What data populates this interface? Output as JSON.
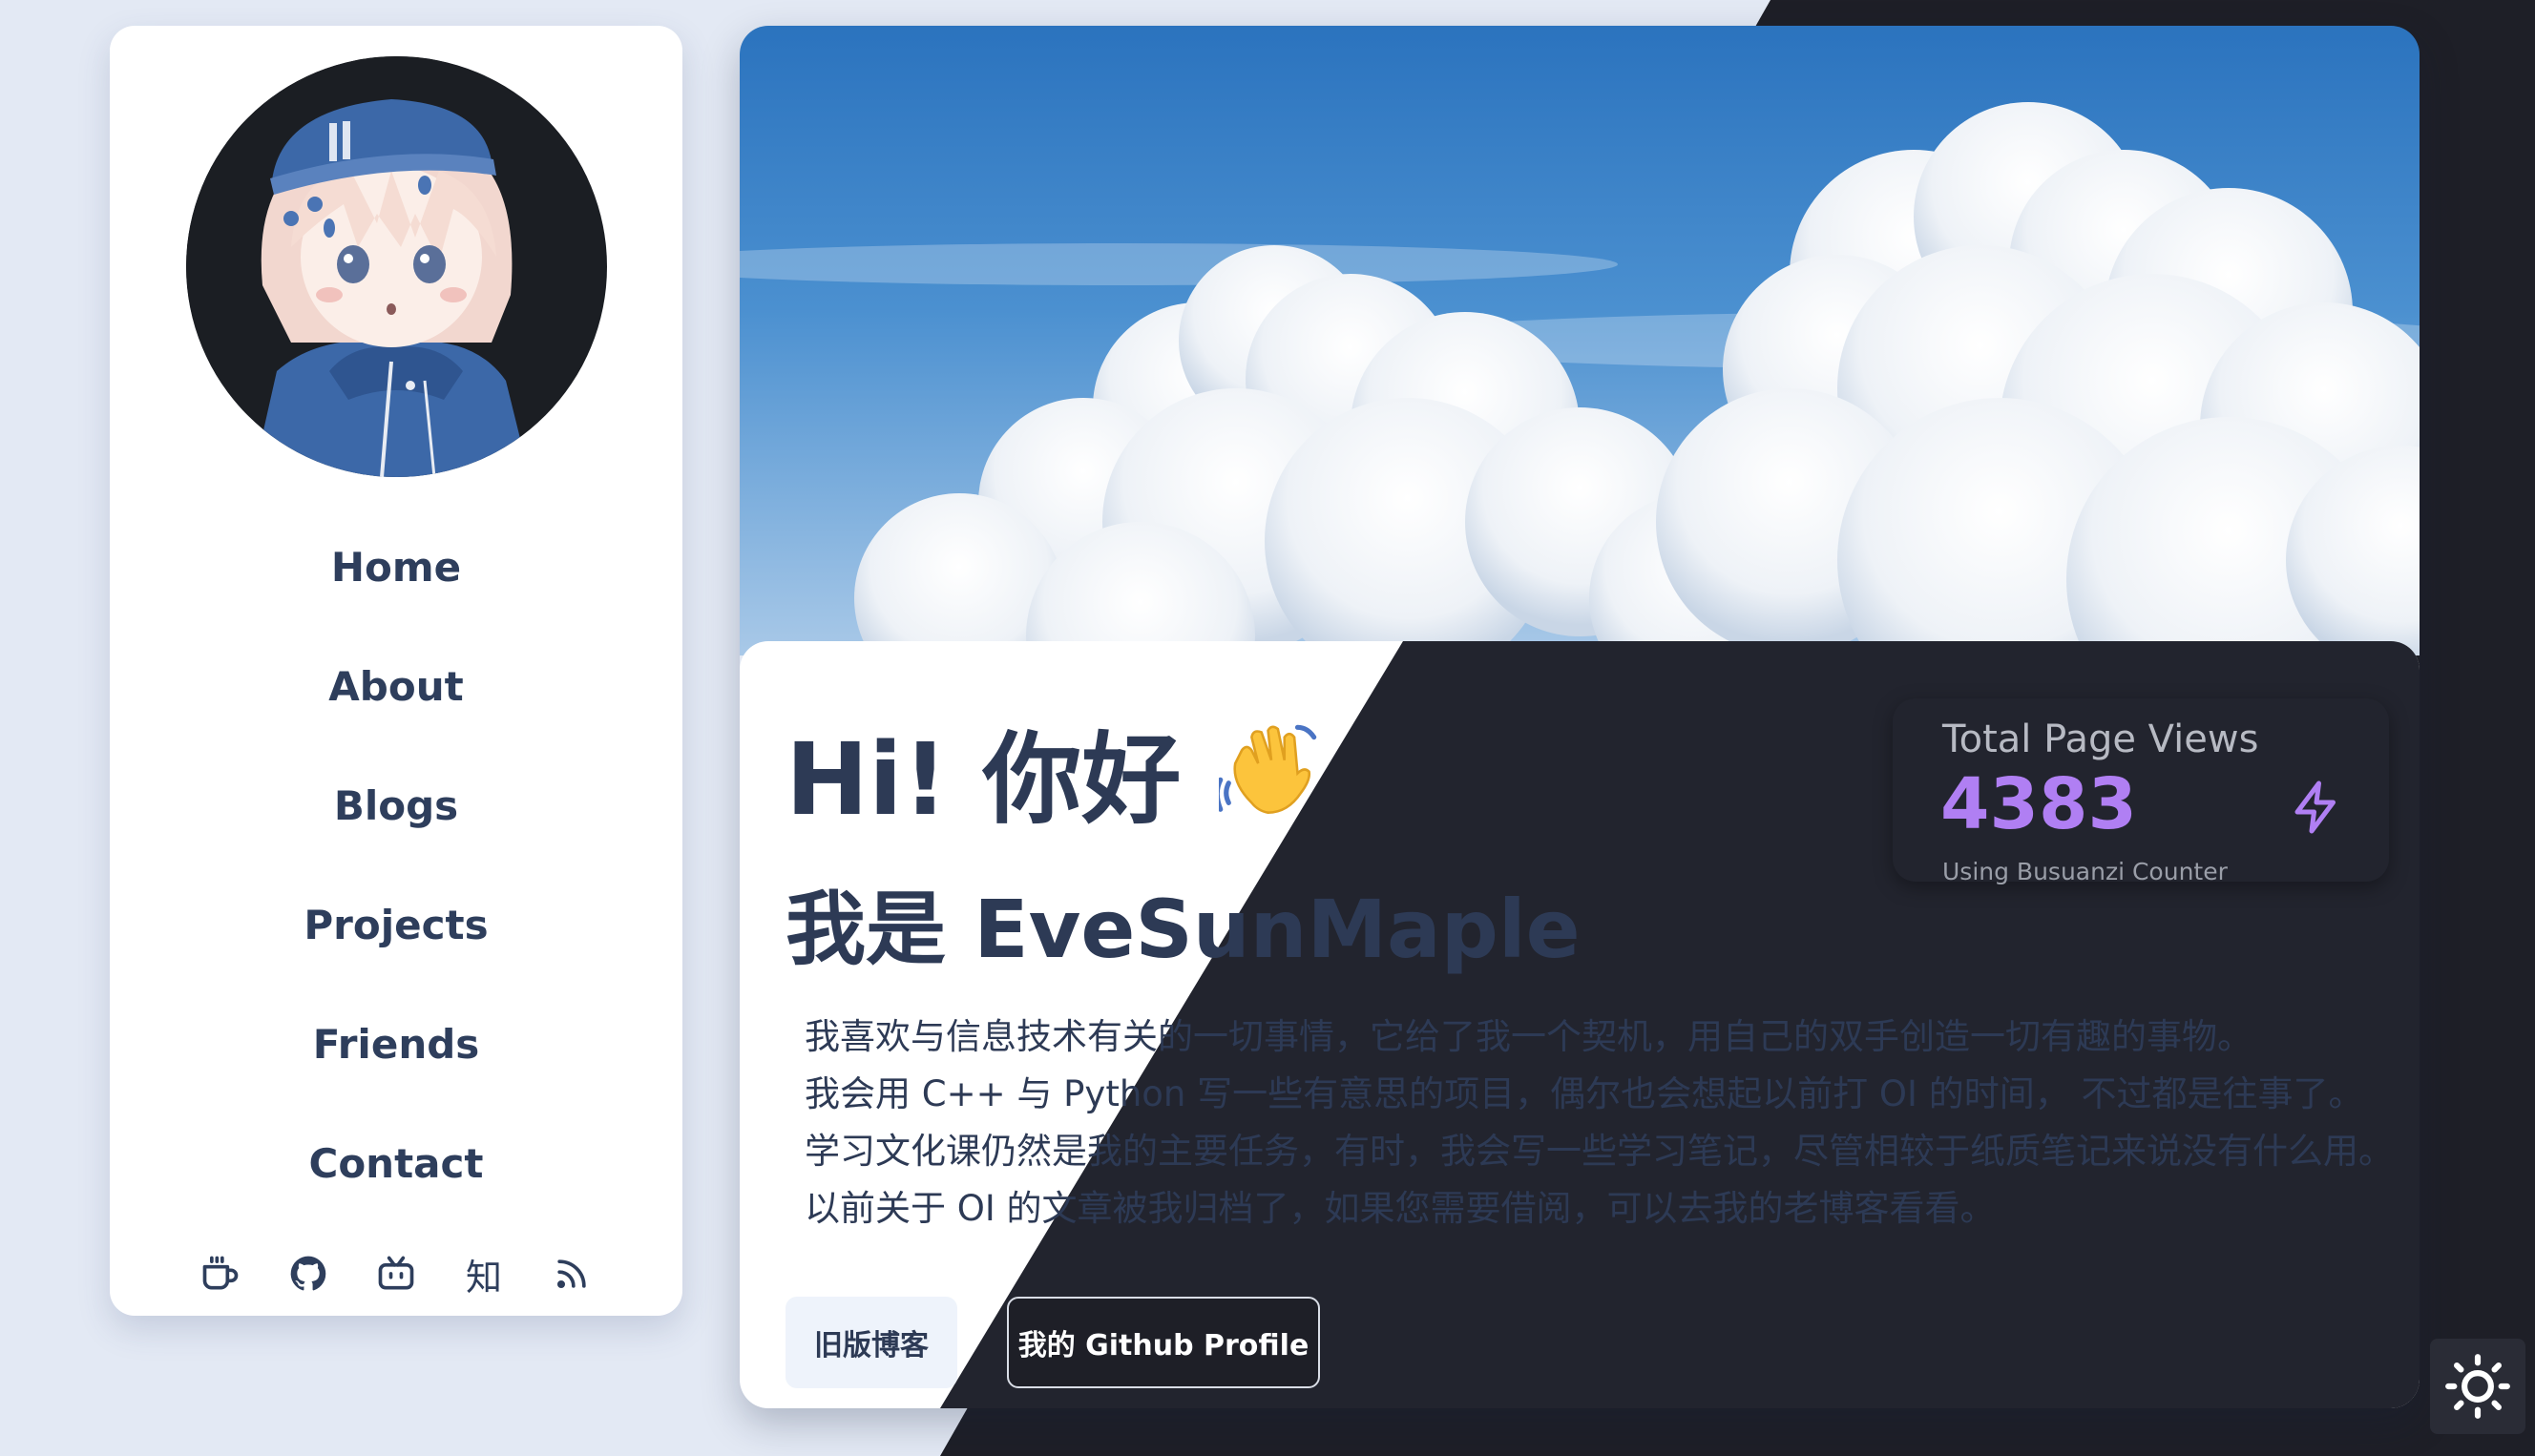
{
  "colors": {
    "page_bg": "#e3e9f4",
    "dark_bg": "#1e1f27",
    "panel_dark": "#22242e",
    "text_primary": "#2d3a55",
    "accent": "#b07ff3"
  },
  "sidebar": {
    "avatar_icon": "avatar-anime-girl",
    "nav": [
      {
        "label": "Home"
      },
      {
        "label": "About"
      },
      {
        "label": "Blogs"
      },
      {
        "label": "Projects"
      },
      {
        "label": "Friends"
      },
      {
        "label": "Contact"
      }
    ],
    "socials": [
      {
        "icon": "coffee-icon"
      },
      {
        "icon": "github-icon"
      },
      {
        "icon": "bilibili-icon"
      },
      {
        "icon": "zhihu-icon",
        "text": "知"
      },
      {
        "icon": "rss-icon"
      }
    ]
  },
  "hero": {
    "image": "sky-clouds-banner",
    "greeting": "Hi! 你好",
    "greeting_icon": "waving-hand-emoji",
    "intro": "我是 EveSunMaple",
    "bio": [
      "我喜欢与信息技术有关的一切事情，它给了我一个契机，用自己的双手创造一切有趣的事物。",
      "我会用 C++ 与 Python 写一些有意思的项目，偶尔也会想起以前打 OI 的时间， 不过都是往事了。",
      "学习文化课仍然是我的主要任务，有时，我会写一些学习笔记，尽管相较于纸质笔记来说没有什么用。",
      "以前关于 OI 的文章被我归档了，如果您需要借阅，可以去我的老博客看看。"
    ],
    "buttons": {
      "old_blog": "旧版博客",
      "github_profile": "我的 Github Profile"
    }
  },
  "stats": {
    "title": "Total Page Views",
    "value": "4383",
    "description": "Using Busuanzi Counter",
    "icon": "lightning-bolt-icon"
  },
  "theme_toggle": {
    "icon": "sun-icon"
  }
}
